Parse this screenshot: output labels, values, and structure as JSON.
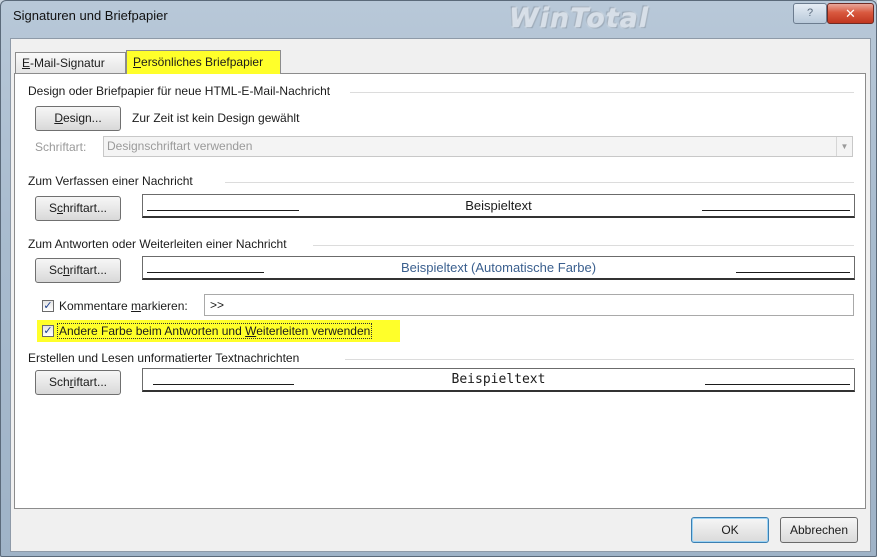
{
  "window": {
    "title": "Signaturen und Briefpapier",
    "brand": "WinTotal",
    "help_label": "?",
    "close_label": "✕"
  },
  "tabs": [
    {
      "label_pre": "",
      "accel": "E",
      "label_post": "-Mail-Signatur"
    },
    {
      "label_pre": "",
      "accel": "P",
      "label_post": "ersönliches Briefpapier"
    }
  ],
  "design_section": {
    "heading": "Design oder Briefpapier für neue HTML-E-Mail-Nachricht",
    "design_button_accel": "D",
    "design_button_rest": "esign...",
    "status": "Zur Zeit ist kein Design gewählt",
    "font_label": "Schriftart:",
    "font_value": "Designschriftart verwenden"
  },
  "compose_section": {
    "heading": "Zum Verfassen einer Nachricht",
    "font_button_pre": "S",
    "font_button_accel": "c",
    "font_button_rest": "hriftart...",
    "preview_text": "Beispieltext",
    "preview_color": "#1b1b1b"
  },
  "reply_section": {
    "heading": "Zum Antworten oder Weiterleiten einer Nachricht",
    "font_button_pre": "Sc",
    "font_button_accel": "h",
    "font_button_rest": "riftart...",
    "preview_text": "Beispieltext (Automatische Farbe)",
    "preview_color": "#3a5f8e",
    "mark_comments_pre": "Kommentare ",
    "mark_comments_accel": "m",
    "mark_comments_post": "arkieren:",
    "mark_comments_checked": true,
    "mark_comments_value": ">>",
    "other_color_pre": "Andere Farbe beim Antworten und ",
    "other_color_accel": "W",
    "other_color_post": "eiterleiten verwenden",
    "other_color_checked": true
  },
  "plaintext_section": {
    "heading": "Erstellen und Lesen unformatierter Textnachrichten",
    "font_button_pre": "Sch",
    "font_button_accel": "r",
    "font_button_rest": "iftart...",
    "preview_text": "Beispieltext"
  },
  "footer": {
    "ok_label": "OK",
    "cancel_label": "Abbrechen"
  },
  "highlight_color": "#ffff2a"
}
